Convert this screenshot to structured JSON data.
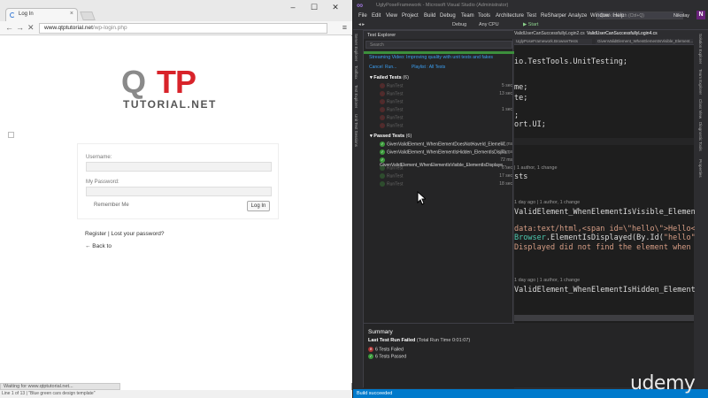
{
  "browser": {
    "window_title": "Log In - Google Chrome",
    "tab_title": "Log In",
    "url_host": "www.qtptutorial.net",
    "url_path": "/wp-login.php",
    "logo_q": "Q",
    "logo_tp": "TP",
    "logo_sub": "TUTORIAL.NET",
    "username_label": "Username:",
    "password_label": "My Password:",
    "remember_label": "Remember Me",
    "login_button": "Log In",
    "register_link": "Register",
    "separator": " | ",
    "lost_password_link": "Lost your password?",
    "back_link": "← Back to",
    "status": "Waiting for www.qtptutorial.net...",
    "bottom_text": "Line 1 of 13 | \"Blue green cars design template\""
  },
  "vs": {
    "title": "UglyPoseFramework - Microsoft Visual Studio (Administrator)",
    "quick_launch": "Quick Launch (Ctrl+Q)",
    "menu": [
      "File",
      "Edit",
      "View",
      "Project",
      "Build",
      "Debug",
      "Team",
      "Tools",
      "Architecture",
      "Test",
      "ReSharper",
      "Analyze",
      "Window",
      "Help"
    ],
    "user": "Nikolay",
    "user_initial": "N",
    "toolbar": {
      "config": "Debug",
      "platform": "Any CPU",
      "start": "▶ Start"
    },
    "left_tabs": [
      "Server Explorer",
      "Toolbox",
      "Test Explorer",
      "Unit Test Sessions"
    ],
    "right_tabs": [
      "Solution Explorer",
      "Team Explorer",
      "Class View",
      "Diagnostic Tools",
      "Properties"
    ],
    "status": "Build succeeded"
  },
  "test_explorer": {
    "title": "Test Explorer",
    "search_placeholder": "Search",
    "banner": "Streaming Video: Improving quality with unit tests and fakes",
    "cancel": "Cancel",
    "run": "Run...",
    "playlist": "Playlist : All Tests",
    "failed_group": "Failed Tests",
    "failed_count": "(6)",
    "failed_tests": [
      {
        "name": "RunTest",
        "time": "5 sec"
      },
      {
        "name": "RunTest",
        "time": "13 sec"
      },
      {
        "name": "RunTest",
        "time": ""
      },
      {
        "name": "RunTest",
        "time": "1 sec"
      },
      {
        "name": "RunTest",
        "time": ""
      },
      {
        "name": "RunTest",
        "time": ""
      }
    ],
    "passed_group": "Passed Tests",
    "passed_count": "(6)",
    "passed_tests": [
      {
        "name": "GivenValidElement_WhenElementDoesNotHaveId_Element...",
        "time": "52 ms"
      },
      {
        "name": "GivenValidElement_WhenElementIsHidden_ElementIsDispla...",
        "time": "75 ms"
      },
      {
        "name": "GivenValidElement_WhenElementIsVisible_ElementIsDisplaye...",
        "time": "72 ms"
      },
      {
        "name": "RunTest",
        "time": "6 sec"
      },
      {
        "name": "RunTest",
        "time": "17 sec"
      },
      {
        "name": "RunTest",
        "time": "18 sec"
      }
    ],
    "summary_title": "Summary",
    "summary_last": "Last Test Run Failed",
    "summary_runtime": "(Total Run Time 0:01:07)",
    "summary_failed": "6 Tests Failed",
    "summary_passed": "6 Tests Passed"
  },
  "editor": {
    "tabs": [
      "ValidUserCanSuccessfullyLogin2.cs",
      "ValidUserCanSuccessfullyLogin4.cs"
    ],
    "nav": [
      "UglyPoseFramework.BrowserTests",
      "GivenValidElement_WhenElementIsVisible_Element..."
    ],
    "lines": [
      {
        "kind": "code",
        "text": "io.TestTools.UnitTesting;"
      },
      {
        "kind": "code",
        "text": "me;"
      },
      {
        "kind": "code",
        "text": "te;"
      },
      {
        "kind": "code",
        "text": ";"
      },
      {
        "kind": "code",
        "text": "ort.UI;"
      },
      {
        "kind": "lens",
        "text": "| 1 author, 1 change"
      },
      {
        "kind": "code",
        "text": "sts"
      },
      {
        "kind": "lens",
        "text": "1 day ago | 1 author, 1 change"
      },
      {
        "kind": "code",
        "text": "ValidElement_WhenElementIsVisible_ElementIsDisp"
      },
      {
        "kind": "str",
        "text": "data:text/html,<span id=\\\"hello\\\">Hello</span>"
      },
      {
        "kind": "code2",
        "text": "Browser.ElementIsDisplayed(By.Id(\"hello\")),"
      },
      {
        "kind": "str",
        "text": "Displayed did not find the element when it was"
      },
      {
        "kind": "lens",
        "text": "1 day ago | 1 author, 1 change"
      },
      {
        "kind": "code",
        "text": "ValidElement_WhenElementIsHidden_ElementIsDispl"
      }
    ]
  },
  "watermark": "udemy"
}
